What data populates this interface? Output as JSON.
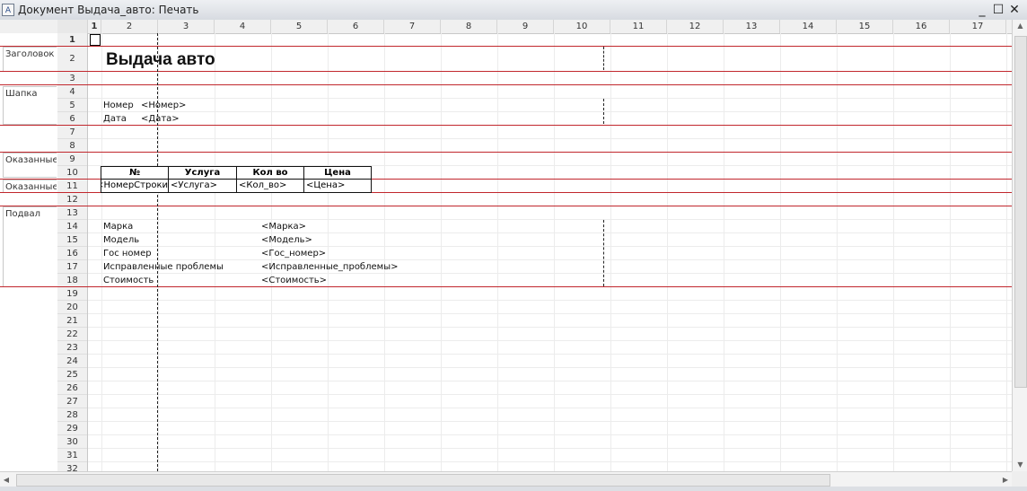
{
  "window": {
    "title": "Документ Выдача_авто: Печать",
    "minimize": "_",
    "maximize": "☐",
    "close": "✕"
  },
  "columns": [
    "1",
    "2",
    "3",
    "4",
    "5",
    "6",
    "7",
    "8",
    "9",
    "10",
    "11",
    "12",
    "13",
    "14",
    "15",
    "16",
    "17"
  ],
  "rows": [
    "1",
    "2",
    "3",
    "4",
    "5",
    "6",
    "7",
    "8",
    "9",
    "10",
    "11",
    "12",
    "13",
    "14",
    "15",
    "16",
    "17",
    "18",
    "19",
    "20",
    "21",
    "22",
    "23",
    "24",
    "25",
    "26",
    "27",
    "28",
    "29",
    "30",
    "31",
    "32"
  ],
  "groups": {
    "header": "Заголовок",
    "cap": "Шапка",
    "services_head": "Оказанные_",
    "services_row": "Оказанные_",
    "footer": "Подвал"
  },
  "doc": {
    "title": "Выдача авто",
    "number_label": "Номер",
    "number_value": "<Номер>",
    "date_label": "Дата",
    "date_value": "<Дата>"
  },
  "table": {
    "headers": [
      "№",
      "Услуга",
      "Кол во",
      "Цена"
    ],
    "row": [
      "НомерСтроки>",
      "<Услуга>",
      "<Кол_во>",
      "<Цена>"
    ]
  },
  "footer": {
    "brand_label": "Марка",
    "brand_value": "<Марка>",
    "model_label": "Модель",
    "model_value": "<Модель>",
    "plate_label": "Гос номер",
    "plate_value": "<Гос_номер>",
    "fixed_label": "Исправленные проблемы",
    "fixed_value": "<Исправленные_проблемы>",
    "cost_label": "Стоимость",
    "cost_value": "<Стоимость>"
  }
}
